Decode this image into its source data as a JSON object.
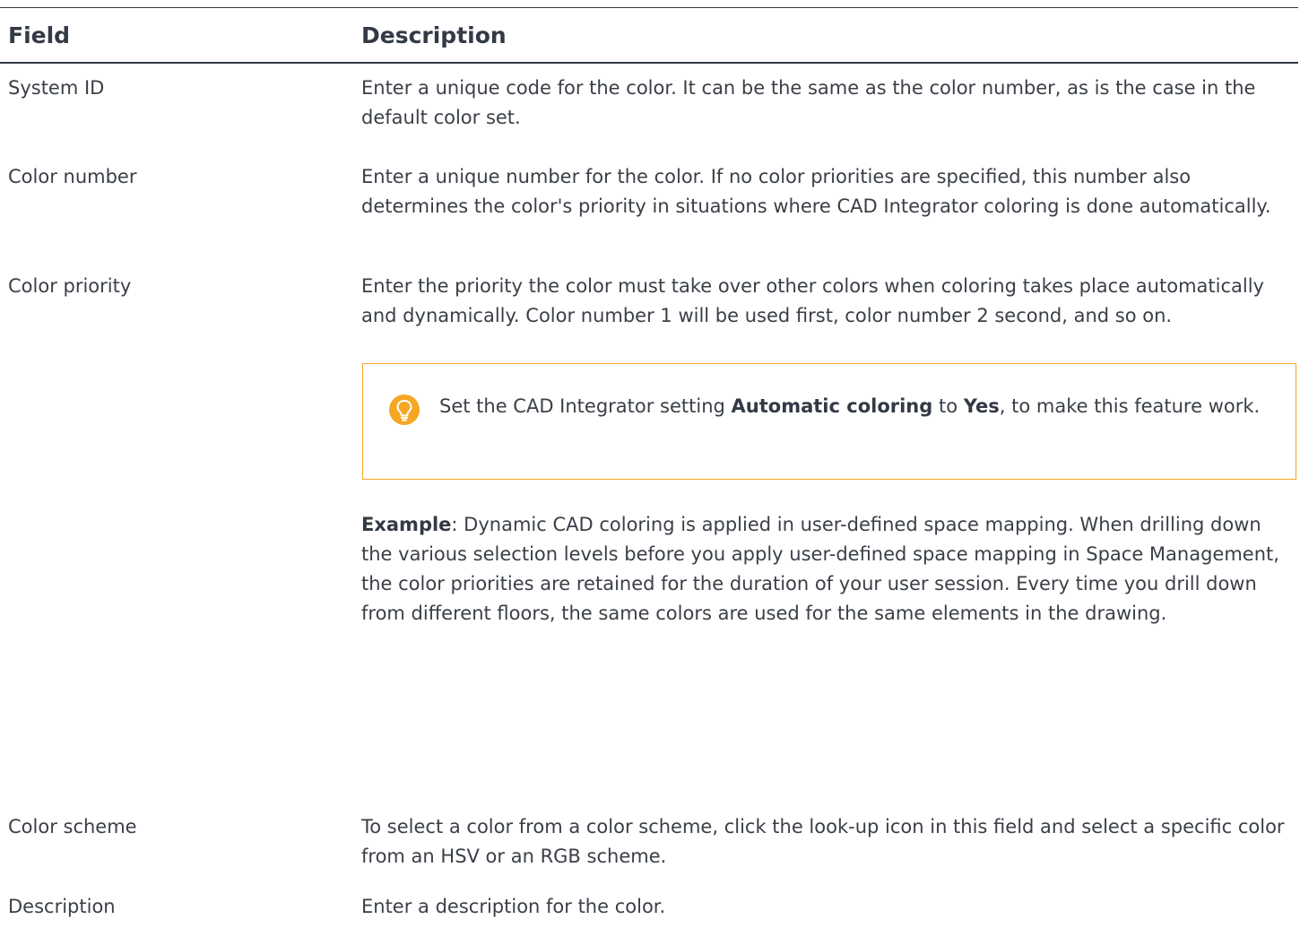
{
  "header": {
    "field": "Field",
    "description": "Description"
  },
  "rows": [
    {
      "field": "System ID",
      "description": "Enter a unique code for the color. It can be the same as the color number, as is the case in the default color set."
    },
    {
      "field": "Color number",
      "description": "Enter a unique number for the color. If no color priorities are specified, this number also determines the color's priority in situations where CAD Integrator coloring is done automatically."
    },
    {
      "field": "Color priority",
      "description": "Enter the priority the color must take over other colors when coloring takes place automatically and dynamically. Color number 1 will be used first, color number 2 second, and so on.",
      "tip": {
        "icon": "lightbulb-icon",
        "text_before": "Set the CAD Integrator setting ",
        "bold_setting": "Automatic coloring",
        "text_middle": " to ",
        "bold_value": "Yes",
        "text_after": ", to make this feature work."
      },
      "example": {
        "label": "Example",
        "text": ": Dynamic CAD coloring is applied in user-defined space mapping. When drilling down the various selection levels before you apply user-defined space mapping in Space Management, the color priorities are retained for the duration of your user session. Every time you drill down from different floors, the same colors are used for the same elements in the drawing."
      }
    },
    {
      "field": "Color scheme",
      "description": "To select a color from a color scheme, click the look-up icon in this field and select a specific color from an HSV or an RGB scheme."
    },
    {
      "field": "Description",
      "description": "Enter a description for the color."
    }
  ],
  "colors": {
    "tip_border": "#f5a623",
    "tip_icon": "#f5a623",
    "rule": "#333a45"
  }
}
